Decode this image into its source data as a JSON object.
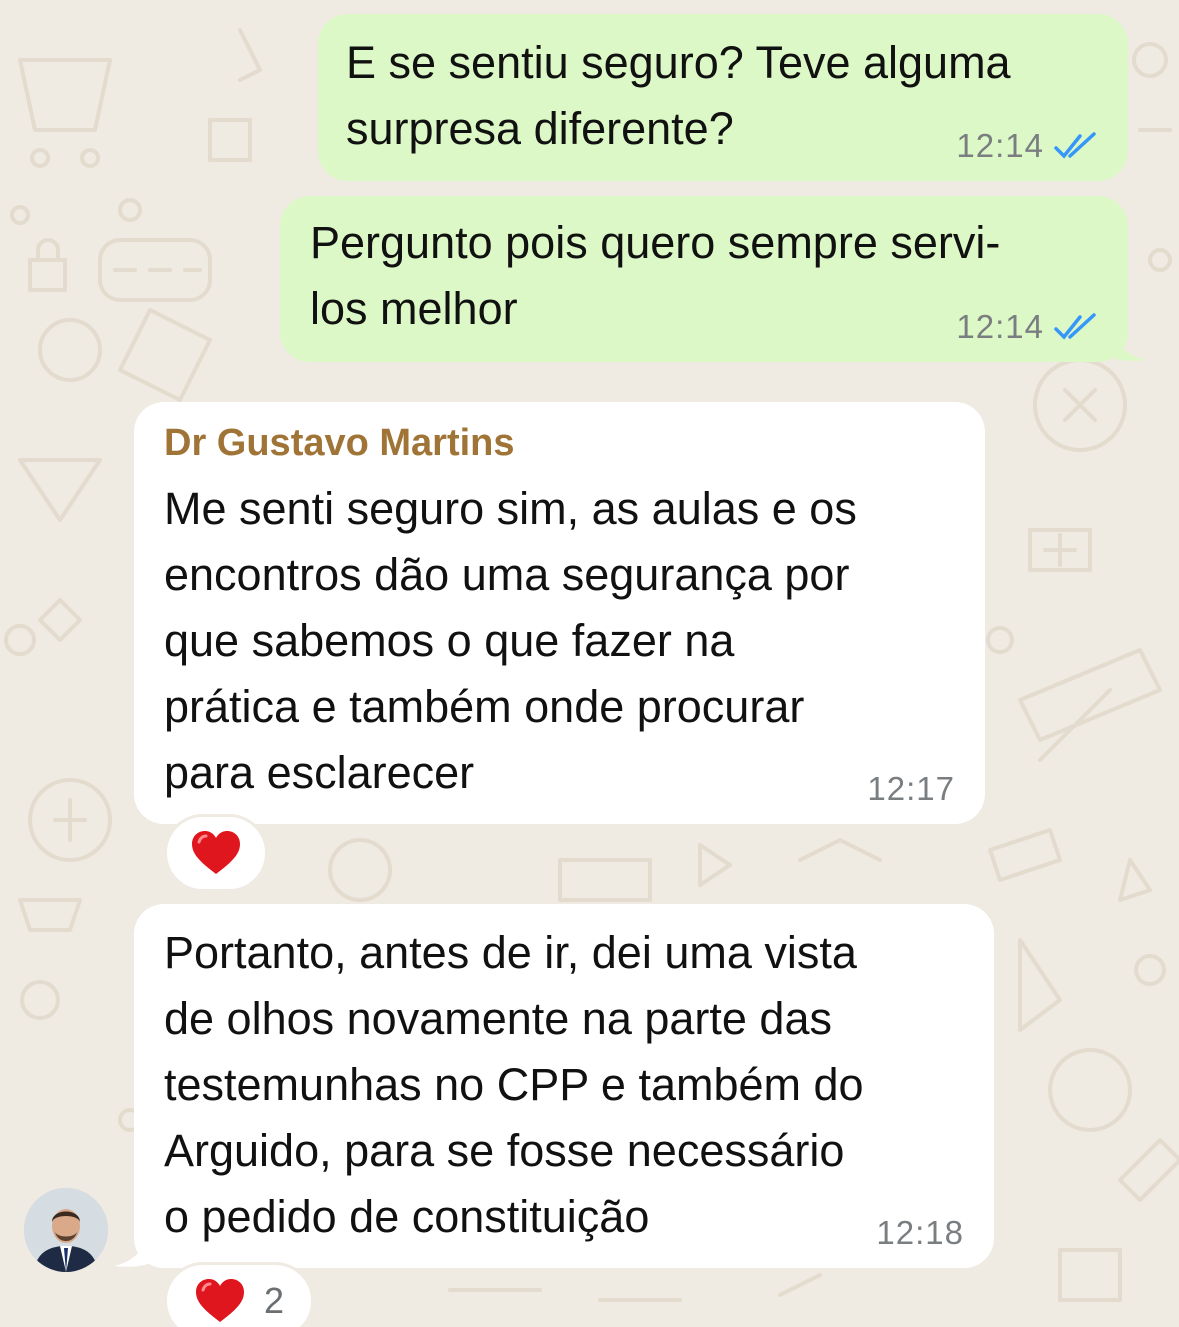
{
  "messages": [
    {
      "direction": "outgoing",
      "text": "E se sentiu seguro? Teve alguma\nsurpresa diferente?",
      "time": "12:14",
      "status_icon": "double-check-read-icon"
    },
    {
      "direction": "outgoing",
      "text": "Pergunto pois quero sempre servi-\nlos melhor",
      "time": "12:14",
      "status_icon": "double-check-read-icon"
    },
    {
      "direction": "incoming",
      "sender": "Dr Gustavo Martins",
      "text": "Me senti seguro sim, as aulas e os\nencontros dão uma segurança por\nque sabemos o que fazer na\nprática e também onde procurar\npara esclarecer",
      "time": "12:17",
      "reaction": {
        "emoji": "❤️",
        "count": ""
      }
    },
    {
      "direction": "incoming",
      "text": "Portanto, antes de ir, dei uma vista\nde olhos novamente na parte das\ntestemunhas no CPP e também do\nArguido, para se fosse necessário\no pedido de constituição",
      "time": "12:18",
      "reaction": {
        "emoji": "❤️",
        "count": "2"
      }
    }
  ],
  "colors": {
    "outgoing_bubble": "#dcf8c6",
    "incoming_bubble": "#ffffff",
    "wallpaper": "#efeae2",
    "sender_name": "#9f7436",
    "read_ticks": "#3497f9",
    "timestamp": "#7a7e80"
  },
  "avatar": {
    "icon": "user-avatar-photo"
  }
}
